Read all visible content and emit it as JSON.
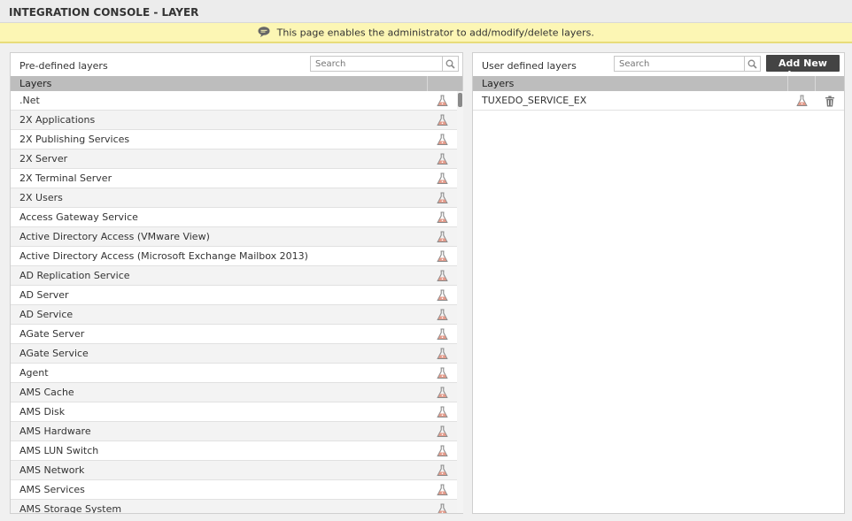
{
  "page": {
    "title": "INTEGRATION CONSOLE - LAYER",
    "info_message": "This page enables the administrator to add/modify/delete layers."
  },
  "left_panel": {
    "title": "Pre-defined layers",
    "search_placeholder": "Search",
    "column_header": "Layers",
    "rows": [
      ".Net",
      "2X Applications",
      "2X Publishing Services",
      "2X Server",
      "2X Terminal Server",
      "2X Users",
      "Access Gateway Service",
      "Active Directory Access (VMware View)",
      "Active Directory Access (Microsoft Exchange Mailbox 2013)",
      "AD Replication Service",
      "AD Server",
      "AD Service",
      "AGate Server",
      "AGate Service",
      "Agent",
      "AMS Cache",
      "AMS Disk",
      "AMS Hardware",
      "AMS LUN Switch",
      "AMS Network",
      "AMS Services",
      "AMS Storage System"
    ]
  },
  "right_panel": {
    "title": "User defined layers",
    "search_placeholder": "Search",
    "add_button_label": "Add New Layer",
    "column_header": "Layers",
    "rows": [
      "TUXEDO_SERVICE_EX"
    ]
  },
  "icons": {
    "info": "speech-bubble-icon",
    "search": "magnifier-icon",
    "test": "flask-icon",
    "delete": "trash-icon"
  },
  "colors": {
    "info_bar": "#fcf6b4",
    "grid_header": "#bdbdbd",
    "add_button": "#444444"
  }
}
